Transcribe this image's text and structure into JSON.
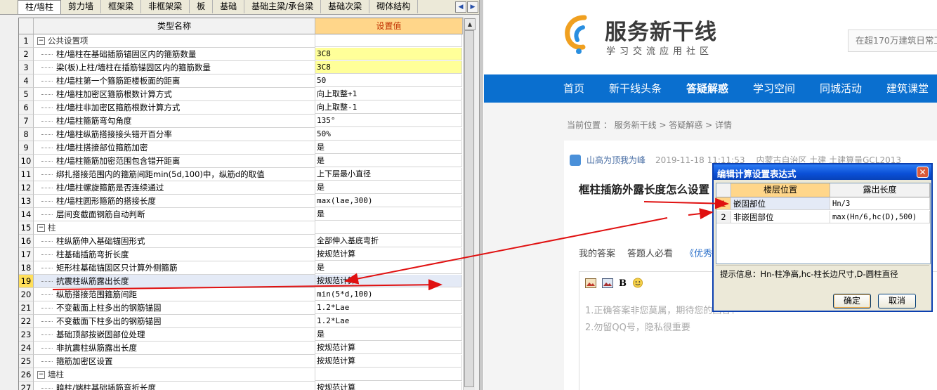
{
  "left_panel": {
    "tabs": [
      "柱/墙柱",
      "剪力墙",
      "框架梁",
      "非框架梁",
      "板",
      "基础",
      "基础主梁/承台梁",
      "基础次梁",
      "砌体结构"
    ],
    "active_tab": 0,
    "columns": {
      "name": "类型名称",
      "value": "设置值"
    },
    "rows": [
      {
        "num": "1",
        "name": "公共设置项",
        "value": "",
        "group": true
      },
      {
        "num": "2",
        "name": "柱/墙柱在基础插筋锚固区内的箍筋数量",
        "value": "3C8",
        "highlight": true
      },
      {
        "num": "3",
        "name": "梁(板)上柱/墙柱在插筋锚固区内的箍筋数量",
        "value": "3C8",
        "highlight": true
      },
      {
        "num": "4",
        "name": "柱/墙柱第一个箍筋距楼板面的距离",
        "value": "50"
      },
      {
        "num": "5",
        "name": "柱/墙柱加密区箍筋根数计算方式",
        "value": "向上取整+1"
      },
      {
        "num": "6",
        "name": "柱/墙柱非加密区箍筋根数计算方式",
        "value": "向上取整-1"
      },
      {
        "num": "7",
        "name": "柱/墙柱箍筋弯勾角度",
        "value": "135°"
      },
      {
        "num": "8",
        "name": "柱/墙柱纵筋搭接接头错开百分率",
        "value": "50%"
      },
      {
        "num": "9",
        "name": "柱/墙柱搭接部位箍筋加密",
        "value": "是"
      },
      {
        "num": "10",
        "name": "柱/墙柱箍筋加密范围包含错开距离",
        "value": "是"
      },
      {
        "num": "11",
        "name": "绑扎搭接范围内的箍筋间距min(5d,100)中，纵筋d的取值",
        "value": "上下层最小直径"
      },
      {
        "num": "12",
        "name": "柱/墙柱螺旋箍筋是否连续通过",
        "value": "是"
      },
      {
        "num": "13",
        "name": "柱/墙柱圆形箍筋的搭接长度",
        "value": "max(lae,300)"
      },
      {
        "num": "14",
        "name": "层间变截面钢筋自动判断",
        "value": "是"
      },
      {
        "num": "15",
        "name": "柱",
        "value": "",
        "group": true
      },
      {
        "num": "16",
        "name": "柱纵筋伸入基础锚固形式",
        "value": "全部伸入基底弯折"
      },
      {
        "num": "17",
        "name": "柱基础插筋弯折长度",
        "value": "按规范计算"
      },
      {
        "num": "18",
        "name": "矩形柱基础锚固区只计算外侧箍筋",
        "value": "是"
      },
      {
        "num": "19",
        "name": "抗震柱纵筋露出长度",
        "value": "按规范计算",
        "selected": true
      },
      {
        "num": "20",
        "name": "纵筋搭接范围箍筋间距",
        "value": "min(5*d,100)"
      },
      {
        "num": "21",
        "name": "不变截面上柱多出的钢筋锚固",
        "value": "1.2*Lae"
      },
      {
        "num": "22",
        "name": "不变截面下柱多出的钢筋锚固",
        "value": "1.2*Lae"
      },
      {
        "num": "23",
        "name": "基础顶部按嵌固部位处理",
        "value": "是"
      },
      {
        "num": "24",
        "name": "非抗震柱纵筋露出长度",
        "value": "按规范计算"
      },
      {
        "num": "25",
        "name": "箍筋加密区设置",
        "value": "按规范计算"
      },
      {
        "num": "26",
        "name": "墙柱",
        "value": "",
        "group": true
      },
      {
        "num": "27",
        "name": "暗柱/端柱基础插筋弯折长度",
        "value": "按规范计算"
      }
    ]
  },
  "website": {
    "logo_title": "服务新干线",
    "logo_subtitle": "学习交流应用社区",
    "search_text": "在超170万建筑日常工",
    "nav": [
      "首页",
      "新干线头条",
      "答疑解惑",
      "学习空间",
      "同城活动",
      "建筑课堂"
    ],
    "nav_active": 2,
    "breadcrumb": "当前位置 ： 服务新干线 > 答疑解惑 > 详情",
    "question": {
      "user": "山高为顶我为峰",
      "time": "2019-11-18 11:11:53",
      "tags": "内蒙古自治区  土建  土建算量GCL2013",
      "title": "框柱插筋外露长度怎么设置"
    },
    "answer_tabs": [
      "我的答案",
      "答题人必看",
      "《优秀"
    ],
    "editor_bold": "B",
    "editor_hints": [
      "1.正确答案非您莫属，期待您的回答！",
      "2.勿留QQ号，隐私很重要"
    ]
  },
  "dialog": {
    "title": "编辑计算设置表达式",
    "close": "✕",
    "columns": {
      "position": "楼层位置",
      "length": "露出长度"
    },
    "rows": [
      {
        "num": "1",
        "position": "嵌固部位",
        "length": "Hn/3",
        "selected": true
      },
      {
        "num": "2",
        "position": "非嵌固部位",
        "length": "max(Hn/6,hc(D),500)"
      }
    ],
    "tip": "提示信息：Hn-柱净高,hc-柱长边尺寸,D-圆柱直径",
    "ok": "确定",
    "cancel": "取消"
  },
  "colors": {
    "nav_bg": "#0a6fcf",
    "arrow": "#e01010",
    "dialog_title": "#0a4fd6",
    "value_highlight": "#ffff99"
  },
  "icons": [
    "expand-minus-icon",
    "scroll-up-arrow-icon",
    "scroll-down-arrow-icon",
    "tab-scroll-left-icon",
    "tab-scroll-right-icon",
    "logo-icon",
    "avatar-icon",
    "image-icon",
    "bold-icon",
    "emoji-icon",
    "close-icon"
  ]
}
